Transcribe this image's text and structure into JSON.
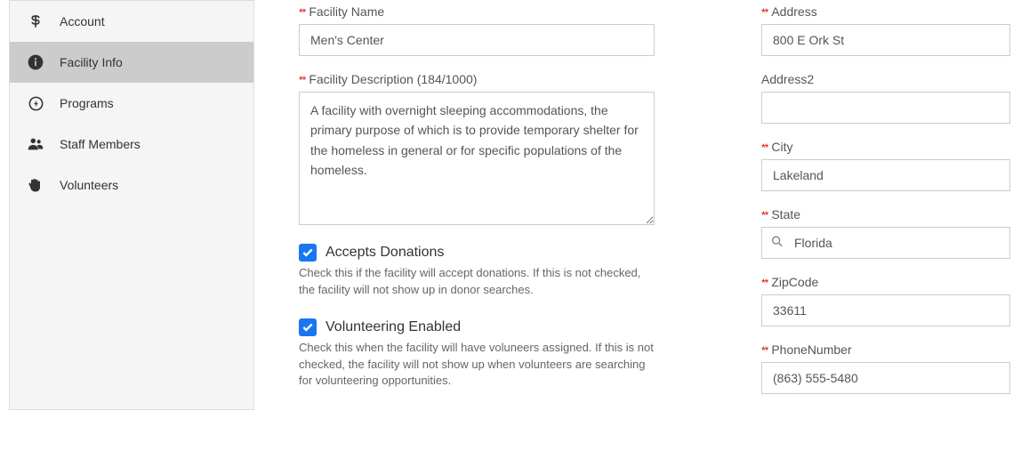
{
  "sidebar": {
    "items": [
      {
        "label": "Account"
      },
      {
        "label": "Facility Info"
      },
      {
        "label": "Programs"
      },
      {
        "label": "Staff Members"
      },
      {
        "label": "Volunteers"
      }
    ]
  },
  "form": {
    "facility_name_label": "Facility Name",
    "facility_name": "Men's Center",
    "facility_desc_label": "Facility Description (184/1000)",
    "facility_desc": "A facility with overnight sleeping accommodations, the primary purpose of which is to provide temporary shelter for the homeless in general or for specific populations of the homeless.",
    "accepts_donations_label": "Accepts Donations",
    "accepts_donations_help": "Check this if the facility will accept donations. If this is not checked, the facility will not show up in donor searches.",
    "volunteering_label": "Volunteering Enabled",
    "volunteering_help": "Check this when the facility will have voluneers assigned. If this is not checked, the facility will not show up when volunteers are searching for volunteering opportunities.",
    "address_label": "Address",
    "address": "800 E Ork St",
    "address2_label": "Address2",
    "address2": "",
    "city_label": "City",
    "city": "Lakeland",
    "state_label": "State",
    "state": "Florida",
    "zip_label": "ZipCode",
    "zip": "33611",
    "phone_label": "PhoneNumber",
    "phone": "(863) 555-5480"
  }
}
